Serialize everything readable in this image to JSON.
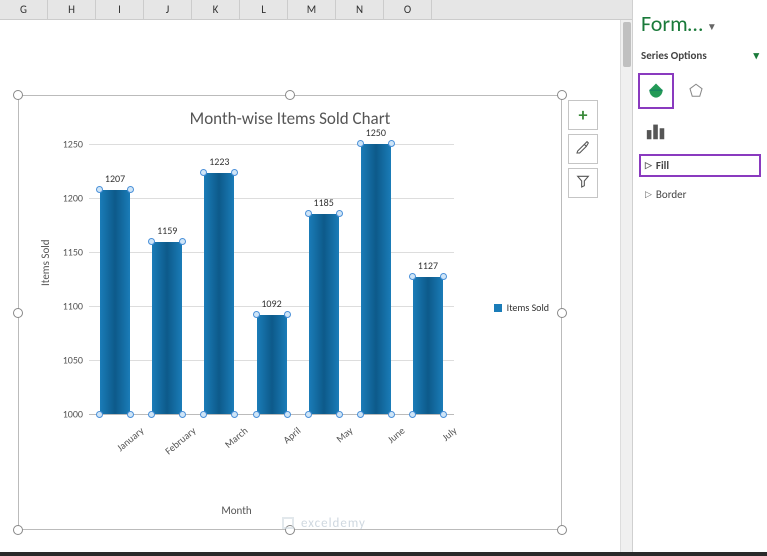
{
  "columns": [
    "G",
    "H",
    "I",
    "J",
    "K",
    "L",
    "M",
    "N",
    "O"
  ],
  "chart_data": {
    "type": "bar",
    "title": "Month-wise Items Sold Chart",
    "xlabel": "Month",
    "ylabel": "Items Sold",
    "categories": [
      "January",
      "February",
      "March",
      "April",
      "May",
      "June",
      "July"
    ],
    "values": [
      1207,
      1159,
      1223,
      1092,
      1185,
      1250,
      1127
    ],
    "ylim": [
      1000,
      1250
    ],
    "ytick_step": 50,
    "series_name": "Items Sold"
  },
  "legend": {
    "label": "Items Sold"
  },
  "chart_buttons": {
    "add": "+",
    "style": "brush",
    "filter": "filter"
  },
  "format_pane": {
    "title": "Form…",
    "series_options": "Series Options",
    "fill": "Fill",
    "border": "Border"
  },
  "watermark": "exceldemy"
}
